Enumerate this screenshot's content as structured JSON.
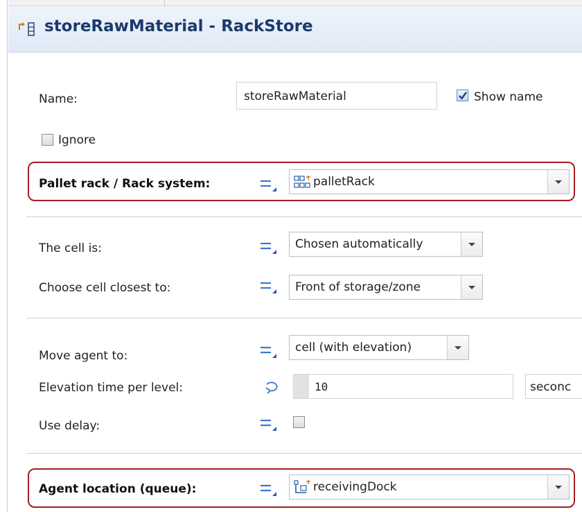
{
  "header": {
    "title": "storeRawMaterial - RackStore",
    "icon": "process-block-icon"
  },
  "name_row": {
    "label": "Name:",
    "value": "storeRawMaterial",
    "show_name_label": "Show name",
    "show_name_checked": true
  },
  "ignore_row": {
    "label": "Ignore",
    "checked": false
  },
  "pallet_rack": {
    "label": "Pallet rack / Rack system:",
    "value": "palletRack",
    "icon": "pallet-rack-icon"
  },
  "cell_is": {
    "label": "The cell is:",
    "value": "Chosen automatically"
  },
  "closest": {
    "label": "Choose cell closest to:",
    "value": "Front of storage/zone"
  },
  "move_agent": {
    "label": "Move agent to:",
    "value": "cell (with elevation)"
  },
  "elevation": {
    "label": "Elevation time per level:",
    "value": "10",
    "unit": "seconc",
    "icon": "dynamic-value-icon"
  },
  "use_delay": {
    "label": "Use delay:",
    "checked": false
  },
  "agent_location": {
    "label": "Agent location (queue):",
    "value": "receivingDock",
    "icon": "path-node-icon"
  },
  "colors": {
    "highlight": "#a31c23",
    "title": "#1b3a6b",
    "eq_icon": "#3a78c8"
  }
}
